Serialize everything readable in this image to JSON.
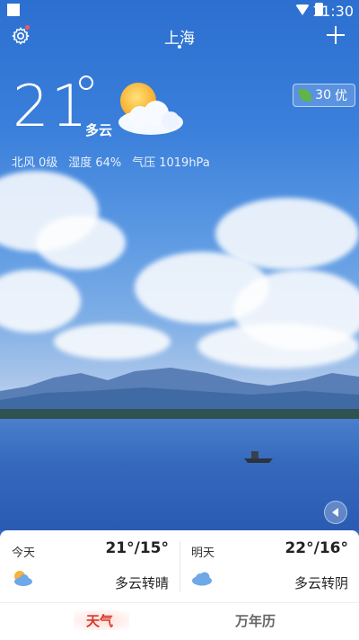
{
  "status_bar": {
    "time": "11:30"
  },
  "header": {
    "city": "上海"
  },
  "current": {
    "temperature": "21",
    "condition": "多云",
    "aqi_value": "30",
    "aqi_level": "优",
    "wind_label": "北风",
    "wind_value": "0级",
    "humidity_label": "湿度",
    "humidity_value": "64%",
    "pressure_label": "气压",
    "pressure_value": "1019hPa"
  },
  "forecast": [
    {
      "day": "今天",
      "temps": "21°/15°",
      "desc": "多云转晴"
    },
    {
      "day": "明天",
      "temps": "22°/16°",
      "desc": "多云转阴"
    }
  ],
  "bottom_nav": {
    "weather": "天气",
    "calendar": "万年历"
  },
  "colors": {
    "accent_red": "#d9362b",
    "aqi_green": "#5fb548"
  }
}
